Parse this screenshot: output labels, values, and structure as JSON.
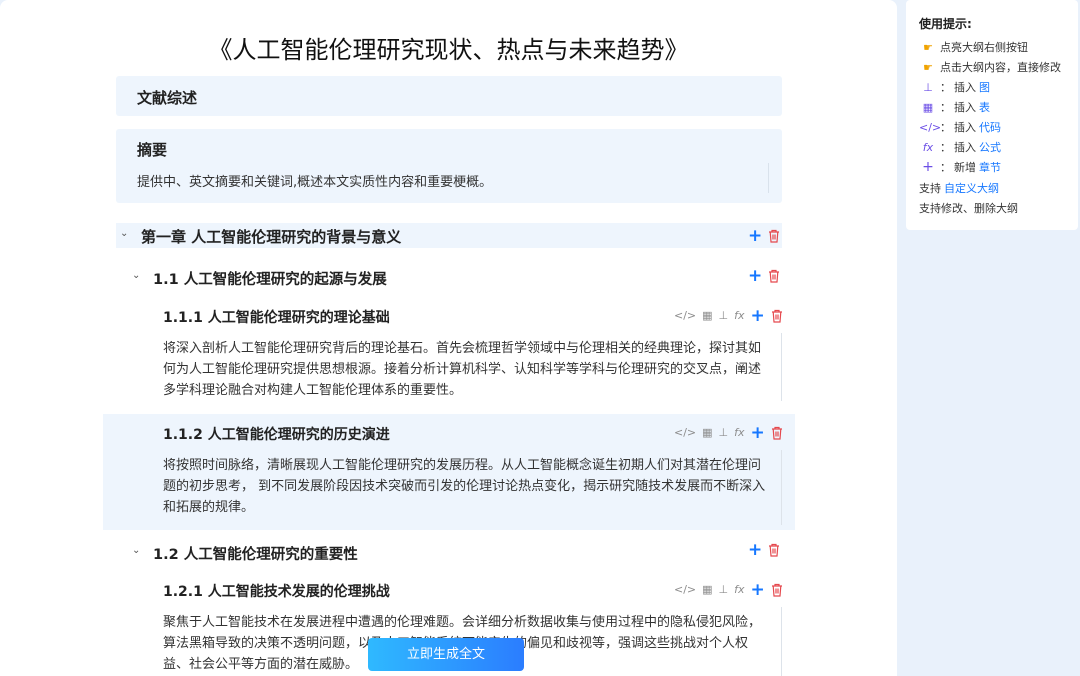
{
  "document": {
    "title": "《人工智能伦理研究现状、热点与未来趋势》",
    "review_label": "文献综述",
    "abstract": {
      "heading": "摘要",
      "desc": "提供中、英文摘要和关键词,概述本文实质性内容和重要梗概。"
    },
    "chapter": {
      "title": "第一章 人工智能伦理研究的背景与意义"
    },
    "sections": [
      {
        "title": "1.1 人工智能伦理研究的起源与发展",
        "subsections": [
          {
            "title": "1.1.1 人工智能伦理研究的理论基础",
            "lines": [
              "将深入剖析人工智能伦理研究背后的理论基石。首先会梳理哲学领域中与伦理相关的经典理论，探讨其如",
              "何为人工智能伦理研究提供思想根源。接着分析计算机科学、认知科学等学科与伦理研究的交叉点，阐述",
              "多学科理论融合对构建人工智能伦理体系的重要性。"
            ]
          },
          {
            "title": "1.1.2 人工智能伦理研究的历史演进",
            "lines": [
              "将按照时间脉络，清晰展现人工智能伦理研究的发展历程。从人工智能概念诞生初期人们对其潜在伦理问",
              "题的初步思考， 到不同发展阶段因技术突破而引发的伦理讨论热点变化，揭示研究随技术发展而不断深入",
              "和拓展的规律。"
            ]
          }
        ]
      },
      {
        "title": "1.2 人工智能伦理研究的重要性",
        "subsections": [
          {
            "title": "1.2.1 人工智能技术发展的伦理挑战",
            "lines": [
              "聚焦于人工智能技术在发展进程中遭遇的伦理难题。会详细分析数据收集与使用过程中的隐私侵犯风险，",
              "算法黑箱导致的决策不透明问题，以及人工智能系统可能产生的偏见和歧视等，强调这些挑战对个人权",
              "益、社会公平等方面的潜在威胁。"
            ]
          }
        ]
      }
    ]
  },
  "generate_button": "立即生成全文",
  "tips": {
    "title": "使用提示:",
    "item1": "点亮大纲右侧按钮",
    "item2": "点击大纲内容，直接修改",
    "insert_prefix": "插入",
    "add_prefix": "新增",
    "chart": "图",
    "table": "表",
    "code": "代码",
    "formula": "公式",
    "section": "章节",
    "custom_prefix": "支持",
    "custom_link": "自定义大纲",
    "modify": "支持修改、删除大纲",
    "colon": "："
  },
  "icons": {
    "code": "code-icon",
    "table": "table-icon",
    "chart": "hierarchy-icon",
    "formula": "fx-icon",
    "add": "plus-icon",
    "delete": "trash-icon",
    "hand": "pointing-hand-icon"
  },
  "colors": {
    "accent": "#1677ff",
    "danger": "#e5484d",
    "highlight": "#eef5fd",
    "button_from": "#2fb9ff",
    "button_to": "#2b7dff"
  }
}
